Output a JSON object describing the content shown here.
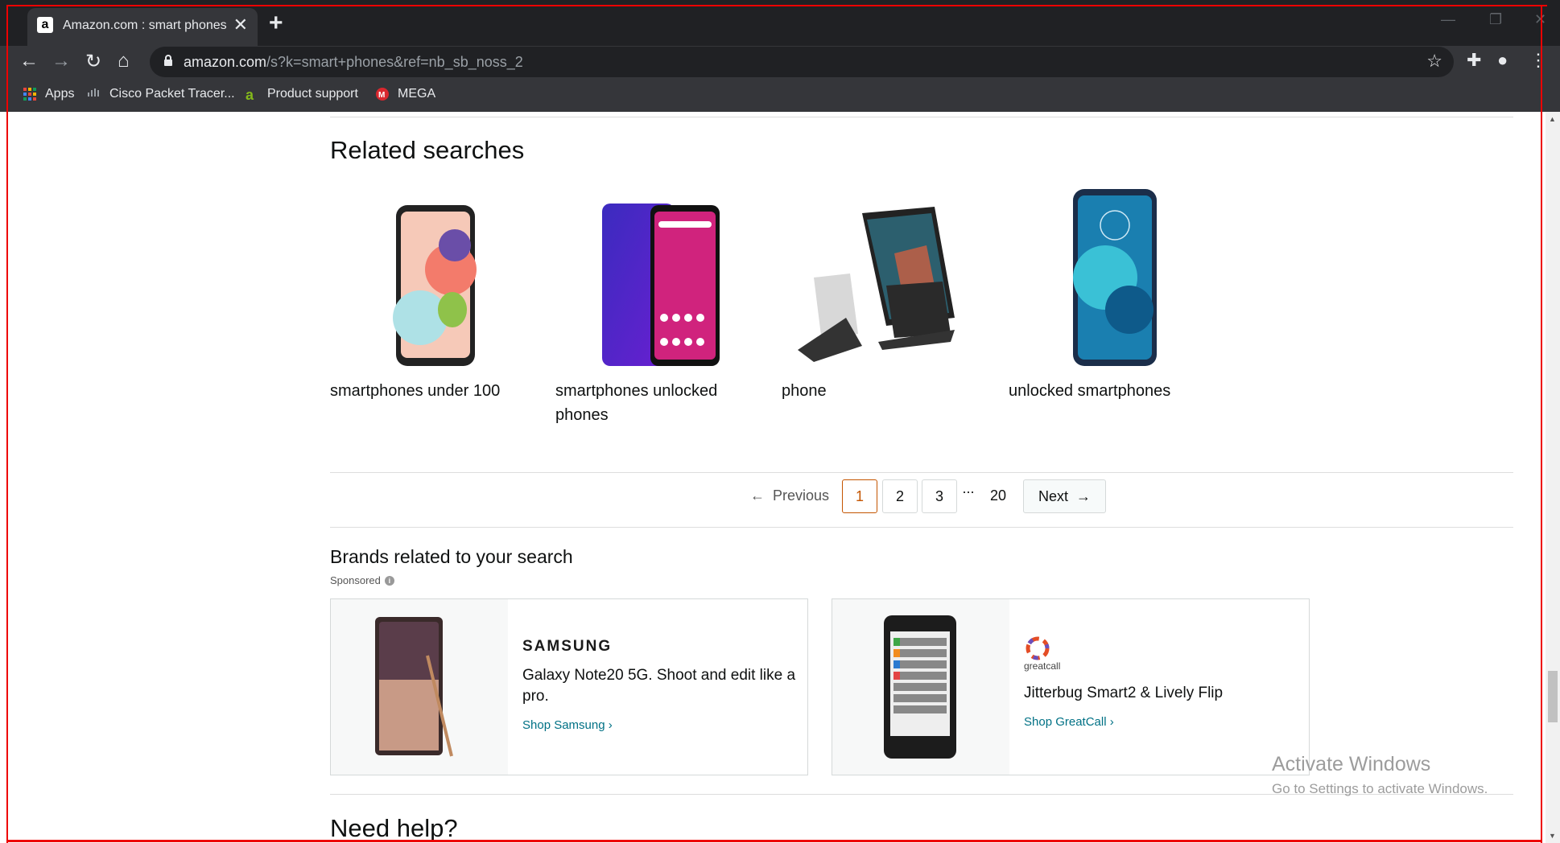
{
  "browser": {
    "tab_title": "Amazon.com : smart phones",
    "tab_favicon": "a",
    "url_host": "amazon.com",
    "url_rest": "/s?k=smart+phones&ref=nb_sb_noss_2",
    "bookmarks": [
      "Apps",
      "Cisco Packet Tracer...",
      "Product support",
      "MEGA"
    ],
    "icons": [
      "back-icon",
      "forward-icon",
      "reload-icon",
      "home-icon",
      "lock-icon",
      "star-icon",
      "extensions-icon",
      "profile-icon",
      "menu-icon"
    ]
  },
  "related": {
    "title": "Related searches",
    "items": [
      {
        "label": "smartphones under 100",
        "icon": "phone-image"
      },
      {
        "label": "smartphones unlocked phones",
        "icon": "phone-image"
      },
      {
        "label": "phone",
        "icon": "phone-stand-image"
      },
      {
        "label": "unlocked smartphones",
        "icon": "phone-image"
      }
    ]
  },
  "pagination": {
    "previous": "Previous",
    "pages": [
      "1",
      "2",
      "3"
    ],
    "ellipsis": "...",
    "last": "20",
    "next": "Next",
    "current": "1"
  },
  "brands": {
    "title": "Brands related to your search",
    "sponsored": "Sponsored",
    "info": "i",
    "cards": [
      {
        "logo": "SAMSUNG",
        "desc": "Galaxy Note20 5G. Shoot and edit like a pro.",
        "link": "Shop Samsung ›"
      },
      {
        "logo": "greatcall",
        "desc": "Jitterbug Smart2 & Lively Flip",
        "link": "Shop GreatCall ›"
      }
    ]
  },
  "need_help": "Need help?",
  "watermark": {
    "line1": "Activate Windows",
    "line2": "Go to Settings to activate Windows."
  },
  "colors": {
    "chrome_dark": "#202124",
    "chrome_bar": "#35363a",
    "link": "#007185",
    "active_page": "#c45500"
  }
}
